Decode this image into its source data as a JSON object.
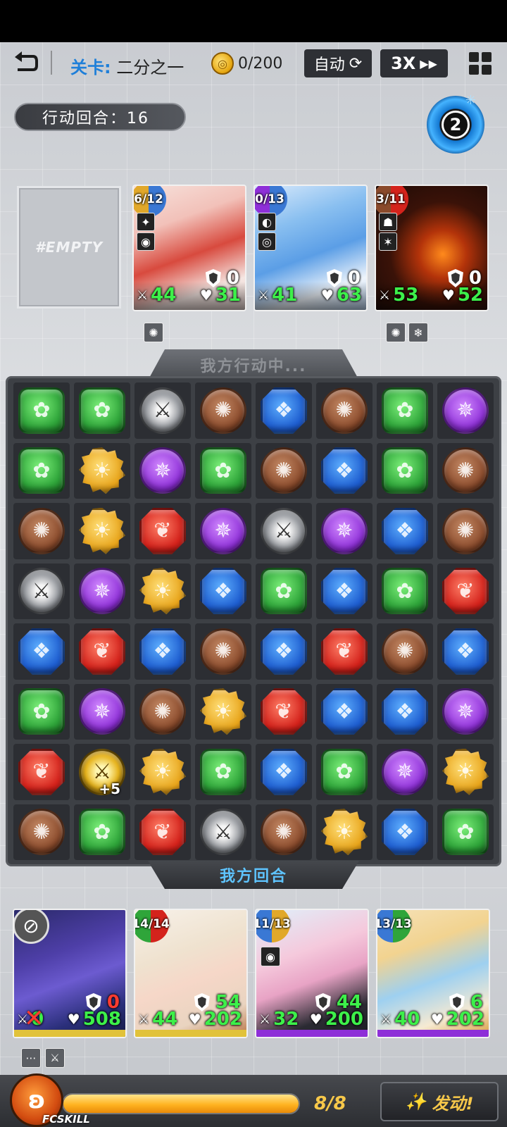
{
  "topbar": {
    "stage_label": "关卡:",
    "stage_name": "二分之一",
    "coins": "0/200",
    "auto_label": "自动",
    "speed_label": "3X",
    "turn_label": "行动回合：16",
    "round_number": "2"
  },
  "enemy_slots": {
    "empty_label": "#EMPTY",
    "cards": [
      {
        "pips": "6/12",
        "shield": "0",
        "atk": "44",
        "hp": "31",
        "colors": [
          "#3a78d4",
          "#e1a82a"
        ]
      },
      {
        "pips": "0/13",
        "shield": "0",
        "atk": "41",
        "hp": "63",
        "colors": [
          "#3a78d4",
          "#8e2fd8"
        ]
      },
      {
        "pips": "3/11",
        "shield": "0",
        "atk": "53",
        "hp": "52",
        "colors": [
          "#d4231c",
          "#8a4a2b"
        ]
      }
    ]
  },
  "board": {
    "header": "我方行动中...",
    "footer": "我方回合",
    "rows": [
      [
        "green",
        "green",
        "sword",
        "brown",
        "blue",
        "brown",
        "green",
        "purple"
      ],
      [
        "green",
        "yellow",
        "purple",
        "green",
        "brown",
        "blue",
        "green",
        "brown"
      ],
      [
        "brown",
        "yellow",
        "red",
        "purple",
        "sword",
        "purple",
        "blue",
        "brown"
      ],
      [
        "sword",
        "purple",
        "yellow",
        "blue",
        "green",
        "blue",
        "green",
        "red"
      ],
      [
        "blue",
        "red",
        "blue",
        "brown",
        "blue",
        "red",
        "brown",
        "blue"
      ],
      [
        "green",
        "purple",
        "brown",
        "yellow",
        "red",
        "blue",
        "blue",
        "purple"
      ],
      [
        "red",
        "gsword",
        "yellow",
        "green",
        "blue",
        "green",
        "purple",
        "yellow"
      ],
      [
        "brown",
        "green",
        "red",
        "sword",
        "brown",
        "yellow",
        "blue",
        "green"
      ]
    ],
    "bonus_label": "+5"
  },
  "party": [
    {
      "pips": "",
      "shield": "0",
      "atk": "0",
      "hp": "508",
      "disabled": true
    },
    {
      "pips": "14/14",
      "shield": "54",
      "atk": "44",
      "hp": "202",
      "colors": [
        "#d4231c",
        "#2fa53a"
      ]
    },
    {
      "pips": "11/13",
      "shield": "44",
      "atk": "32",
      "hp": "200",
      "colors": [
        "#e1a82a",
        "#3a78d4"
      ]
    },
    {
      "pips": "13/13",
      "shield": "6",
      "atk": "40",
      "hp": "202",
      "colors": [
        "#2fa53a",
        "#3a78d4"
      ]
    }
  ],
  "footer": {
    "fc_label": "FCSKILL",
    "energy_text": "8/8",
    "energy_fraction": 1.0,
    "fire_label": "发动!"
  }
}
